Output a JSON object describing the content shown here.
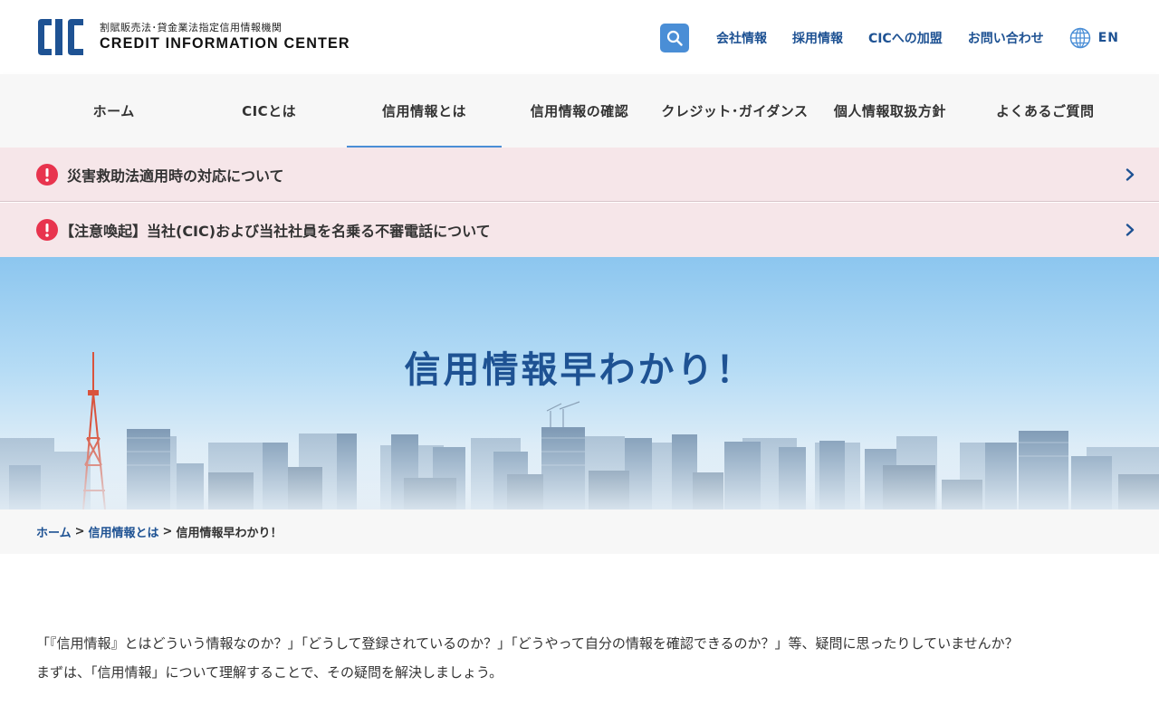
{
  "header": {
    "logo": {
      "mark_text": "CIC",
      "subtitle": "割賦販売法･貸金業法指定信用情報機関",
      "name": "CREDIT INFORMATION CENTER"
    },
    "utility_links": [
      {
        "label": "会社情報"
      },
      {
        "label": "採用情報"
      },
      {
        "label": "CICへの加盟"
      },
      {
        "label": "お問い合わせ"
      }
    ],
    "language_label": "EN",
    "search_icon": "search-icon",
    "globe_icon": "globe-icon"
  },
  "global_nav": {
    "items": [
      {
        "label": "ホーム",
        "active": false
      },
      {
        "label": "CICとは",
        "active": false
      },
      {
        "label": "信用情報とは",
        "active": true
      },
      {
        "label": "信用情報の確認",
        "active": false
      },
      {
        "label": "クレジット･ガイダンス",
        "active": false
      },
      {
        "label": "個人情報取扱方針",
        "active": false
      },
      {
        "label": "よくあるご質問",
        "active": false
      }
    ]
  },
  "alerts": [
    {
      "text": "災害救助法適用時の対応について",
      "icon": "exclamation-icon"
    },
    {
      "text": "【注意喚起】当社(CIC)および当社社員を名乗る不審電話について",
      "icon": "exclamation-icon"
    }
  ],
  "hero": {
    "title": "信用情報早わかり！"
  },
  "breadcrumb": {
    "home": "ホーム",
    "parent": "信用情報とは",
    "current": "信用情報早わかり！",
    "separator": ">"
  },
  "intro": {
    "line1": "「『信用情報』とはどういう情報なのか？」「どうして登録されているのか？」「どうやって自分の情報を確認できるのか？」等、疑問に思ったりしていませんか？",
    "line2": "まずは、「信用情報」について理解することで、その疑問を解決しましょう。"
  },
  "colors": {
    "brand_blue": "#1e5293",
    "accent_blue": "#4a8ed6",
    "alert_bg": "#f6e6e9",
    "alert_icon": "#e8344e"
  }
}
